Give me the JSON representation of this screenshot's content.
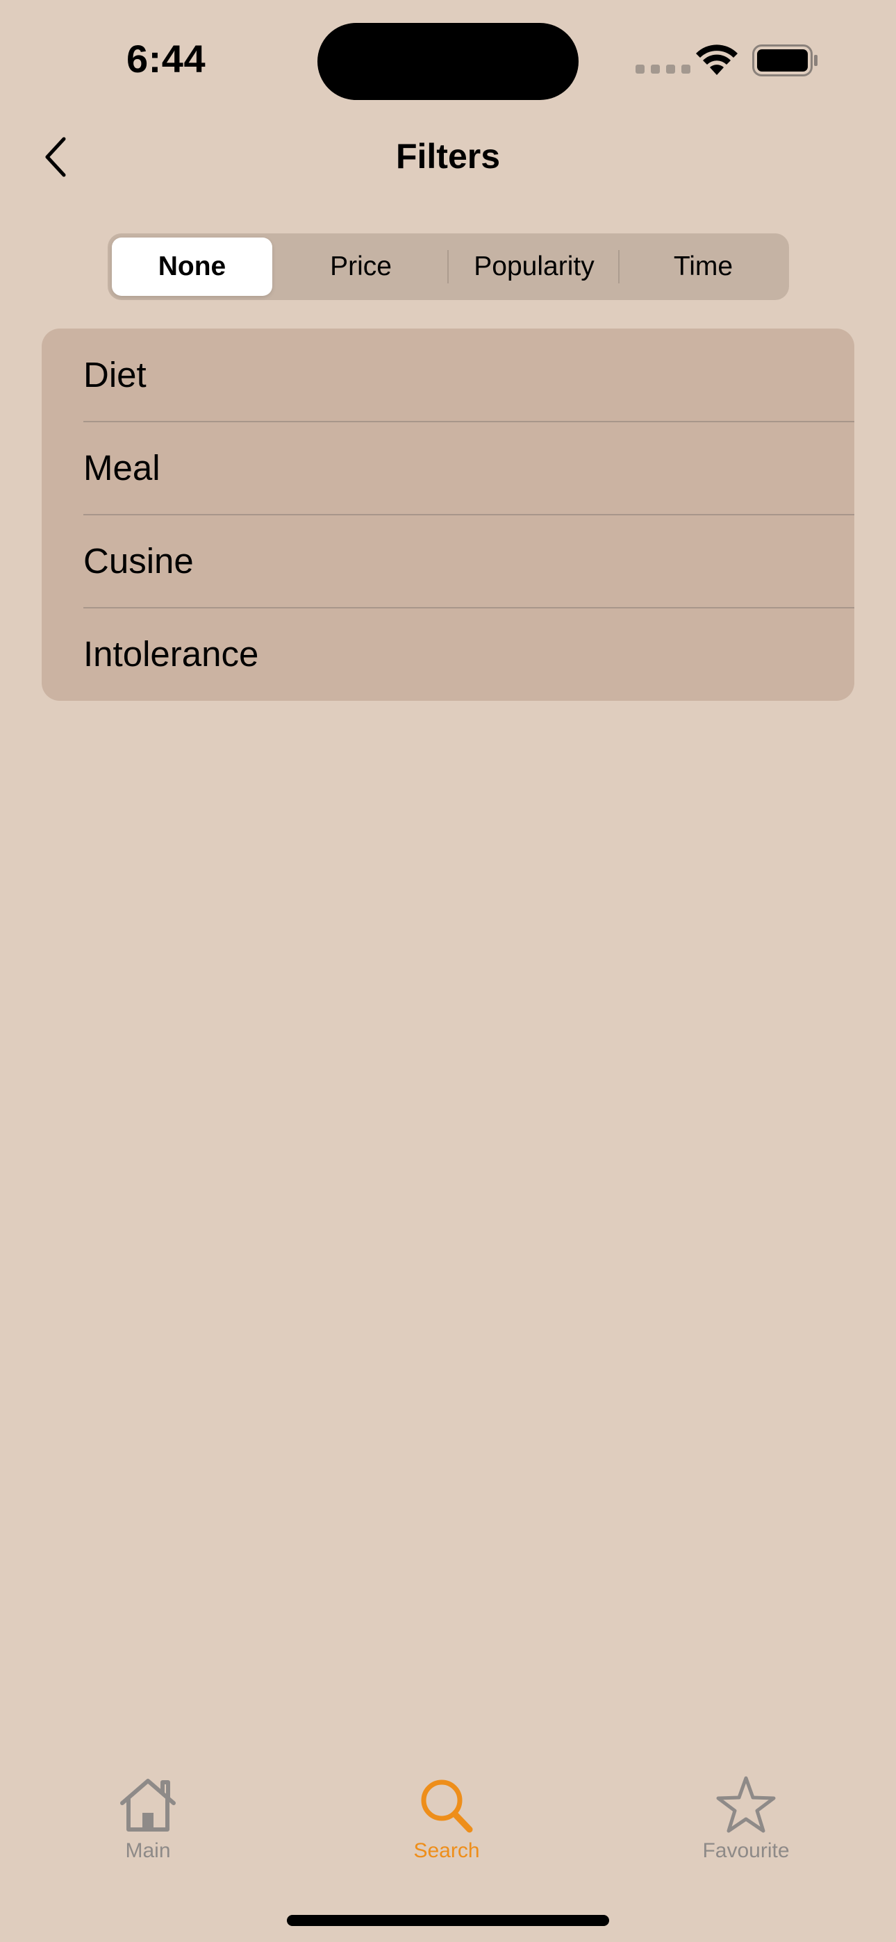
{
  "status_bar": {
    "time": "6:44"
  },
  "nav": {
    "title": "Filters",
    "back_icon": "chevron-left-icon"
  },
  "sort_segments": {
    "selected_index": 0,
    "items": [
      {
        "label": "None"
      },
      {
        "label": "Price"
      },
      {
        "label": "Popularity"
      },
      {
        "label": "Time"
      }
    ]
  },
  "filter_list": {
    "items": [
      {
        "label": "Diet"
      },
      {
        "label": "Meal"
      },
      {
        "label": "Cusine"
      },
      {
        "label": "Intolerance"
      }
    ]
  },
  "tab_bar": {
    "active_index": 1,
    "tabs": [
      {
        "label": "Main",
        "icon": "house-icon"
      },
      {
        "label": "Search",
        "icon": "magnifying-glass-icon"
      },
      {
        "label": "Favourite",
        "icon": "star-icon"
      }
    ]
  },
  "colors": {
    "background": "#DFCDBE",
    "card": "#CBB3A2",
    "segmented_track": "#C5B3A4",
    "accent": "#EE8E1A",
    "inactive_tab": "#8E8A88"
  }
}
